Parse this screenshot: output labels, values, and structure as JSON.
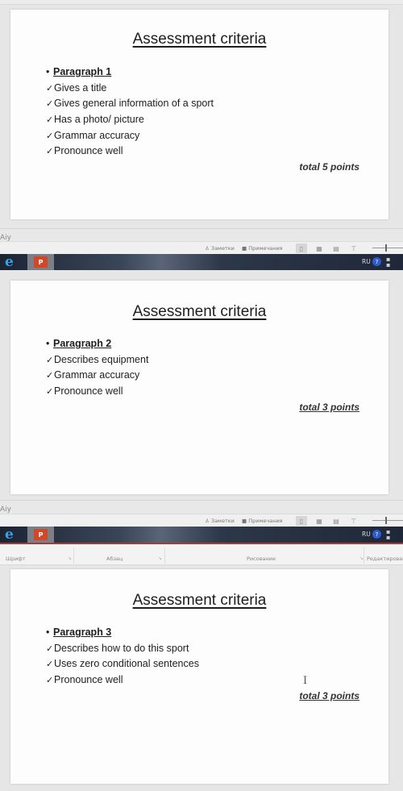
{
  "slides": [
    {
      "title": "Assessment criteria",
      "bullet": "•",
      "heading": "Paragraph 1",
      "items": [
        "Gives a title",
        "Gives general information of a sport",
        "Has a photo/ picture",
        "Grammar accuracy",
        "Pronounce well"
      ],
      "total": "total 5 points"
    },
    {
      "title": "Assessment criteria",
      "bullet": "•",
      "heading": "Paragraph 2",
      "items": [
        "Describes equipment",
        "Grammar accuracy",
        "Pronounce well"
      ],
      "total": "total 3 points"
    },
    {
      "title": "Assessment criteria",
      "bullet": "•",
      "heading": "Paragraph 3",
      "items": [
        "Describes how to do this sport",
        "Uses zero conditional sentences",
        "Pronounce well"
      ],
      "total": "total 3 points"
    }
  ],
  "check_glyph": "✓",
  "status_bar": {
    "left_text": "Aiy",
    "notes_label": "Заметки",
    "comments_label": "Примечания",
    "notes_icon": "notes-icon",
    "comments_icon": "comment-icon"
  },
  "view_buttons": [
    "normal-view",
    "slide-sorter-view",
    "reading-view",
    "slideshow-view"
  ],
  "taskbar": {
    "ie_glyph": "e",
    "ppt_glyph": "P",
    "language": "RU",
    "help_glyph": "?",
    "tray_glyph": "⁚"
  },
  "ribbon": {
    "groups": [
      "Шрифт",
      "Абзац",
      "Рисование",
      "Редактирование"
    ]
  },
  "colors": {
    "ppt_accent": "#d24726",
    "ribbon_accent": "#a43a3a",
    "ie_blue": "#37a0e6",
    "help_blue": "#2d5bd1"
  }
}
